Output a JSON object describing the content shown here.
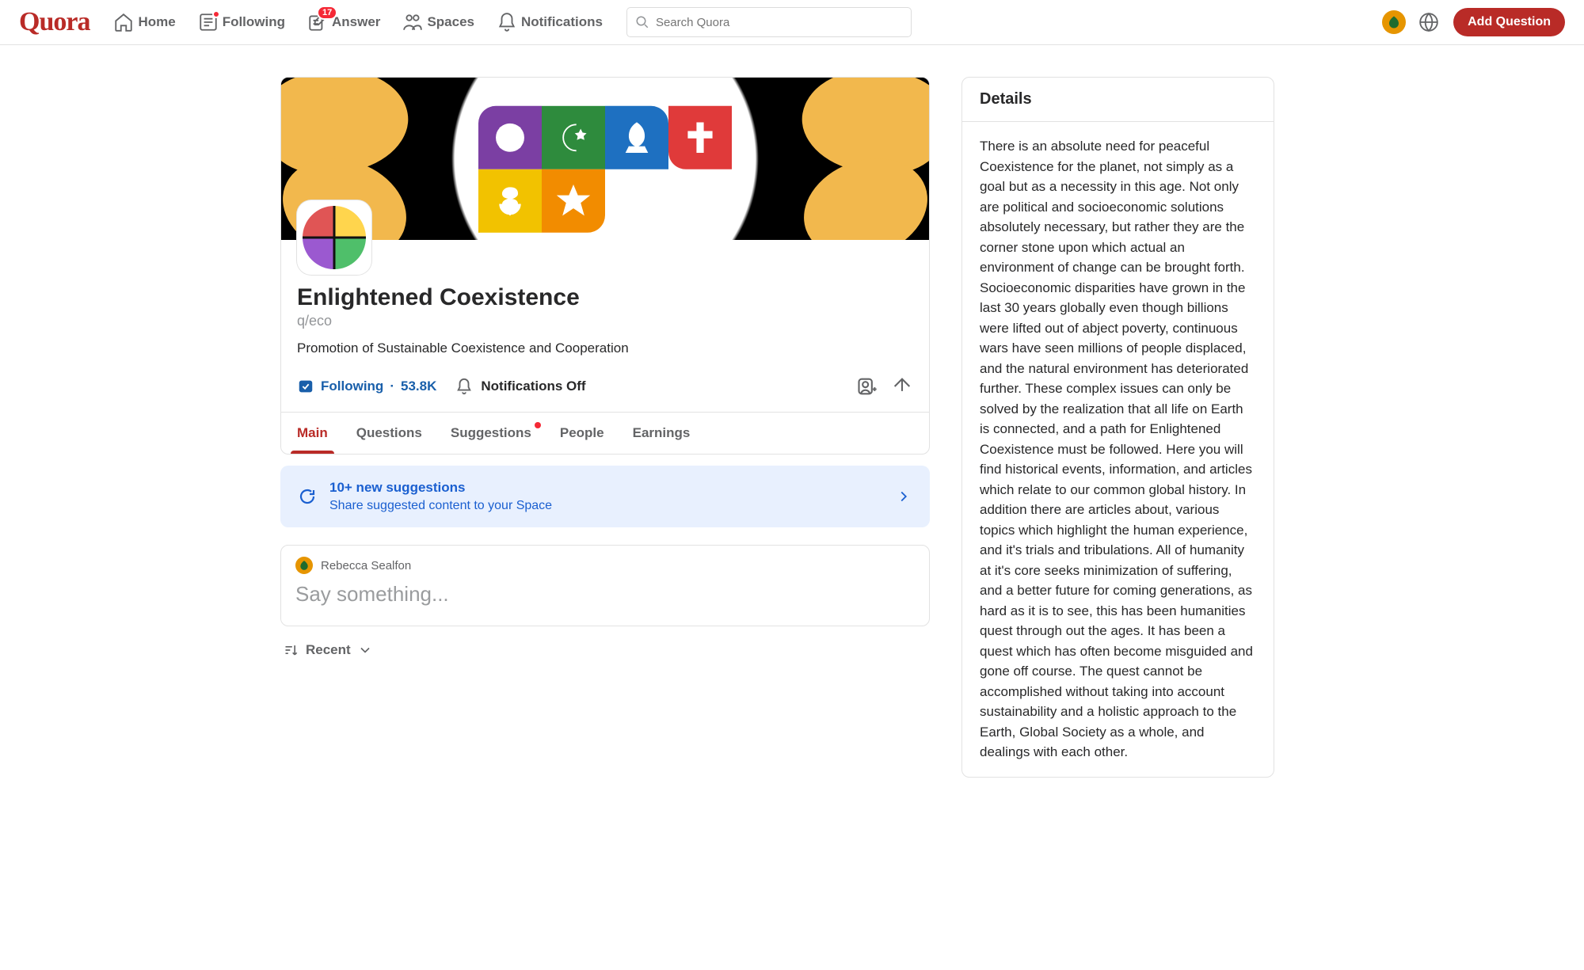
{
  "header": {
    "logo": "Quora",
    "nav": {
      "home": "Home",
      "following": "Following",
      "answer": "Answer",
      "answer_badge": "17",
      "spaces": "Spaces",
      "notifications": "Notifications"
    },
    "search_placeholder": "Search Quora",
    "add_question": "Add Question"
  },
  "space": {
    "title": "Enlightened Coexistence",
    "slug": "q/eco",
    "description": "Promotion of Sustainable Coexistence and Cooperation",
    "follow_label": "Following",
    "follow_count": "53.8K",
    "notifications_label": "Notifications Off"
  },
  "tabs": {
    "main": "Main",
    "questions": "Questions",
    "suggestions": "Suggestions",
    "people": "People",
    "earnings": "Earnings"
  },
  "suggestions_banner": {
    "title": "10+ new suggestions",
    "subtitle": "Share suggested content to your Space"
  },
  "composer": {
    "user": "Rebecca Sealfon",
    "prompt": "Say something..."
  },
  "recent_label": "Recent",
  "details": {
    "heading": "Details",
    "body": "There is an absolute need for peaceful Coexistence for the planet, not simply as a goal but as a necessity in this age. Not only are political and socioeconomic solutions absolutely necessary, but rather they are the corner stone upon which actual an environment of change can be brought forth. Socioeconomic disparities have grown in the last 30 years globally even though billions were lifted out of abject poverty, continuous wars have seen millions of people displaced, and the natural environment has deteriorated further. These complex issues can only be solved by the realization that all life on Earth is connected, and a path for Enlightened Coexistence must be followed. Here you will find historical events, information, and articles which relate to our common global history. In addition there are articles about, various topics which highlight the human experience, and it's trials and tribulations. All of humanity at it's core seeks minimization of suffering, and a better future for coming generations, as hard as it is to see, this has been humanities quest through out the ages. It has been a quest which has often become misguided and gone off course. The quest cannot be accomplished without taking into account sustainability and a holistic approach to the Earth, Global Society as a whole, and dealings with each other."
  }
}
